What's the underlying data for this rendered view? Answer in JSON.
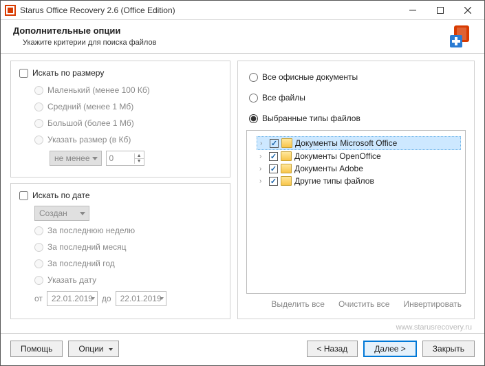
{
  "window": {
    "title": "Starus Office Recovery 2.6 (Office Edition)"
  },
  "header": {
    "title": "Дополнительные опции",
    "subtitle": "Укажите критерии для поиска файлов"
  },
  "size": {
    "check_label": "Искать по размеру",
    "r1": "Маленький (менее 100 Кб)",
    "r2": "Средний (менее 1 Мб)",
    "r3": "Большой (более 1 Мб)",
    "r4": "Указать размер (в Кб)",
    "combo": "не менее",
    "val": "0"
  },
  "date": {
    "check_label": "Искать по дате",
    "combo": "Создан",
    "r1": "За последнюю неделю",
    "r2": "За последний месяц",
    "r3": "За последний год",
    "r4": "Указать дату",
    "from_label": "от",
    "from_val": "22.01.2019",
    "to_label": "до",
    "to_val": "22.01.2019"
  },
  "filter": {
    "r1": "Все офисные документы",
    "r2": "Все файлы",
    "r3": "Выбранные типы файлов"
  },
  "tree": {
    "i1": "Документы Microsoft Office",
    "i2": "Документы OpenOffice",
    "i3": "Документы Adobe",
    "i4": "Другие типы файлов"
  },
  "actions": {
    "select_all": "Выделить все",
    "clear_all": "Очистить все",
    "invert": "Инвертировать"
  },
  "footer": {
    "help": "Помощь",
    "options": "Опции",
    "back": "< Назад",
    "next": "Далее >",
    "close": "Закрыть",
    "url": "www.starusrecovery.ru"
  }
}
